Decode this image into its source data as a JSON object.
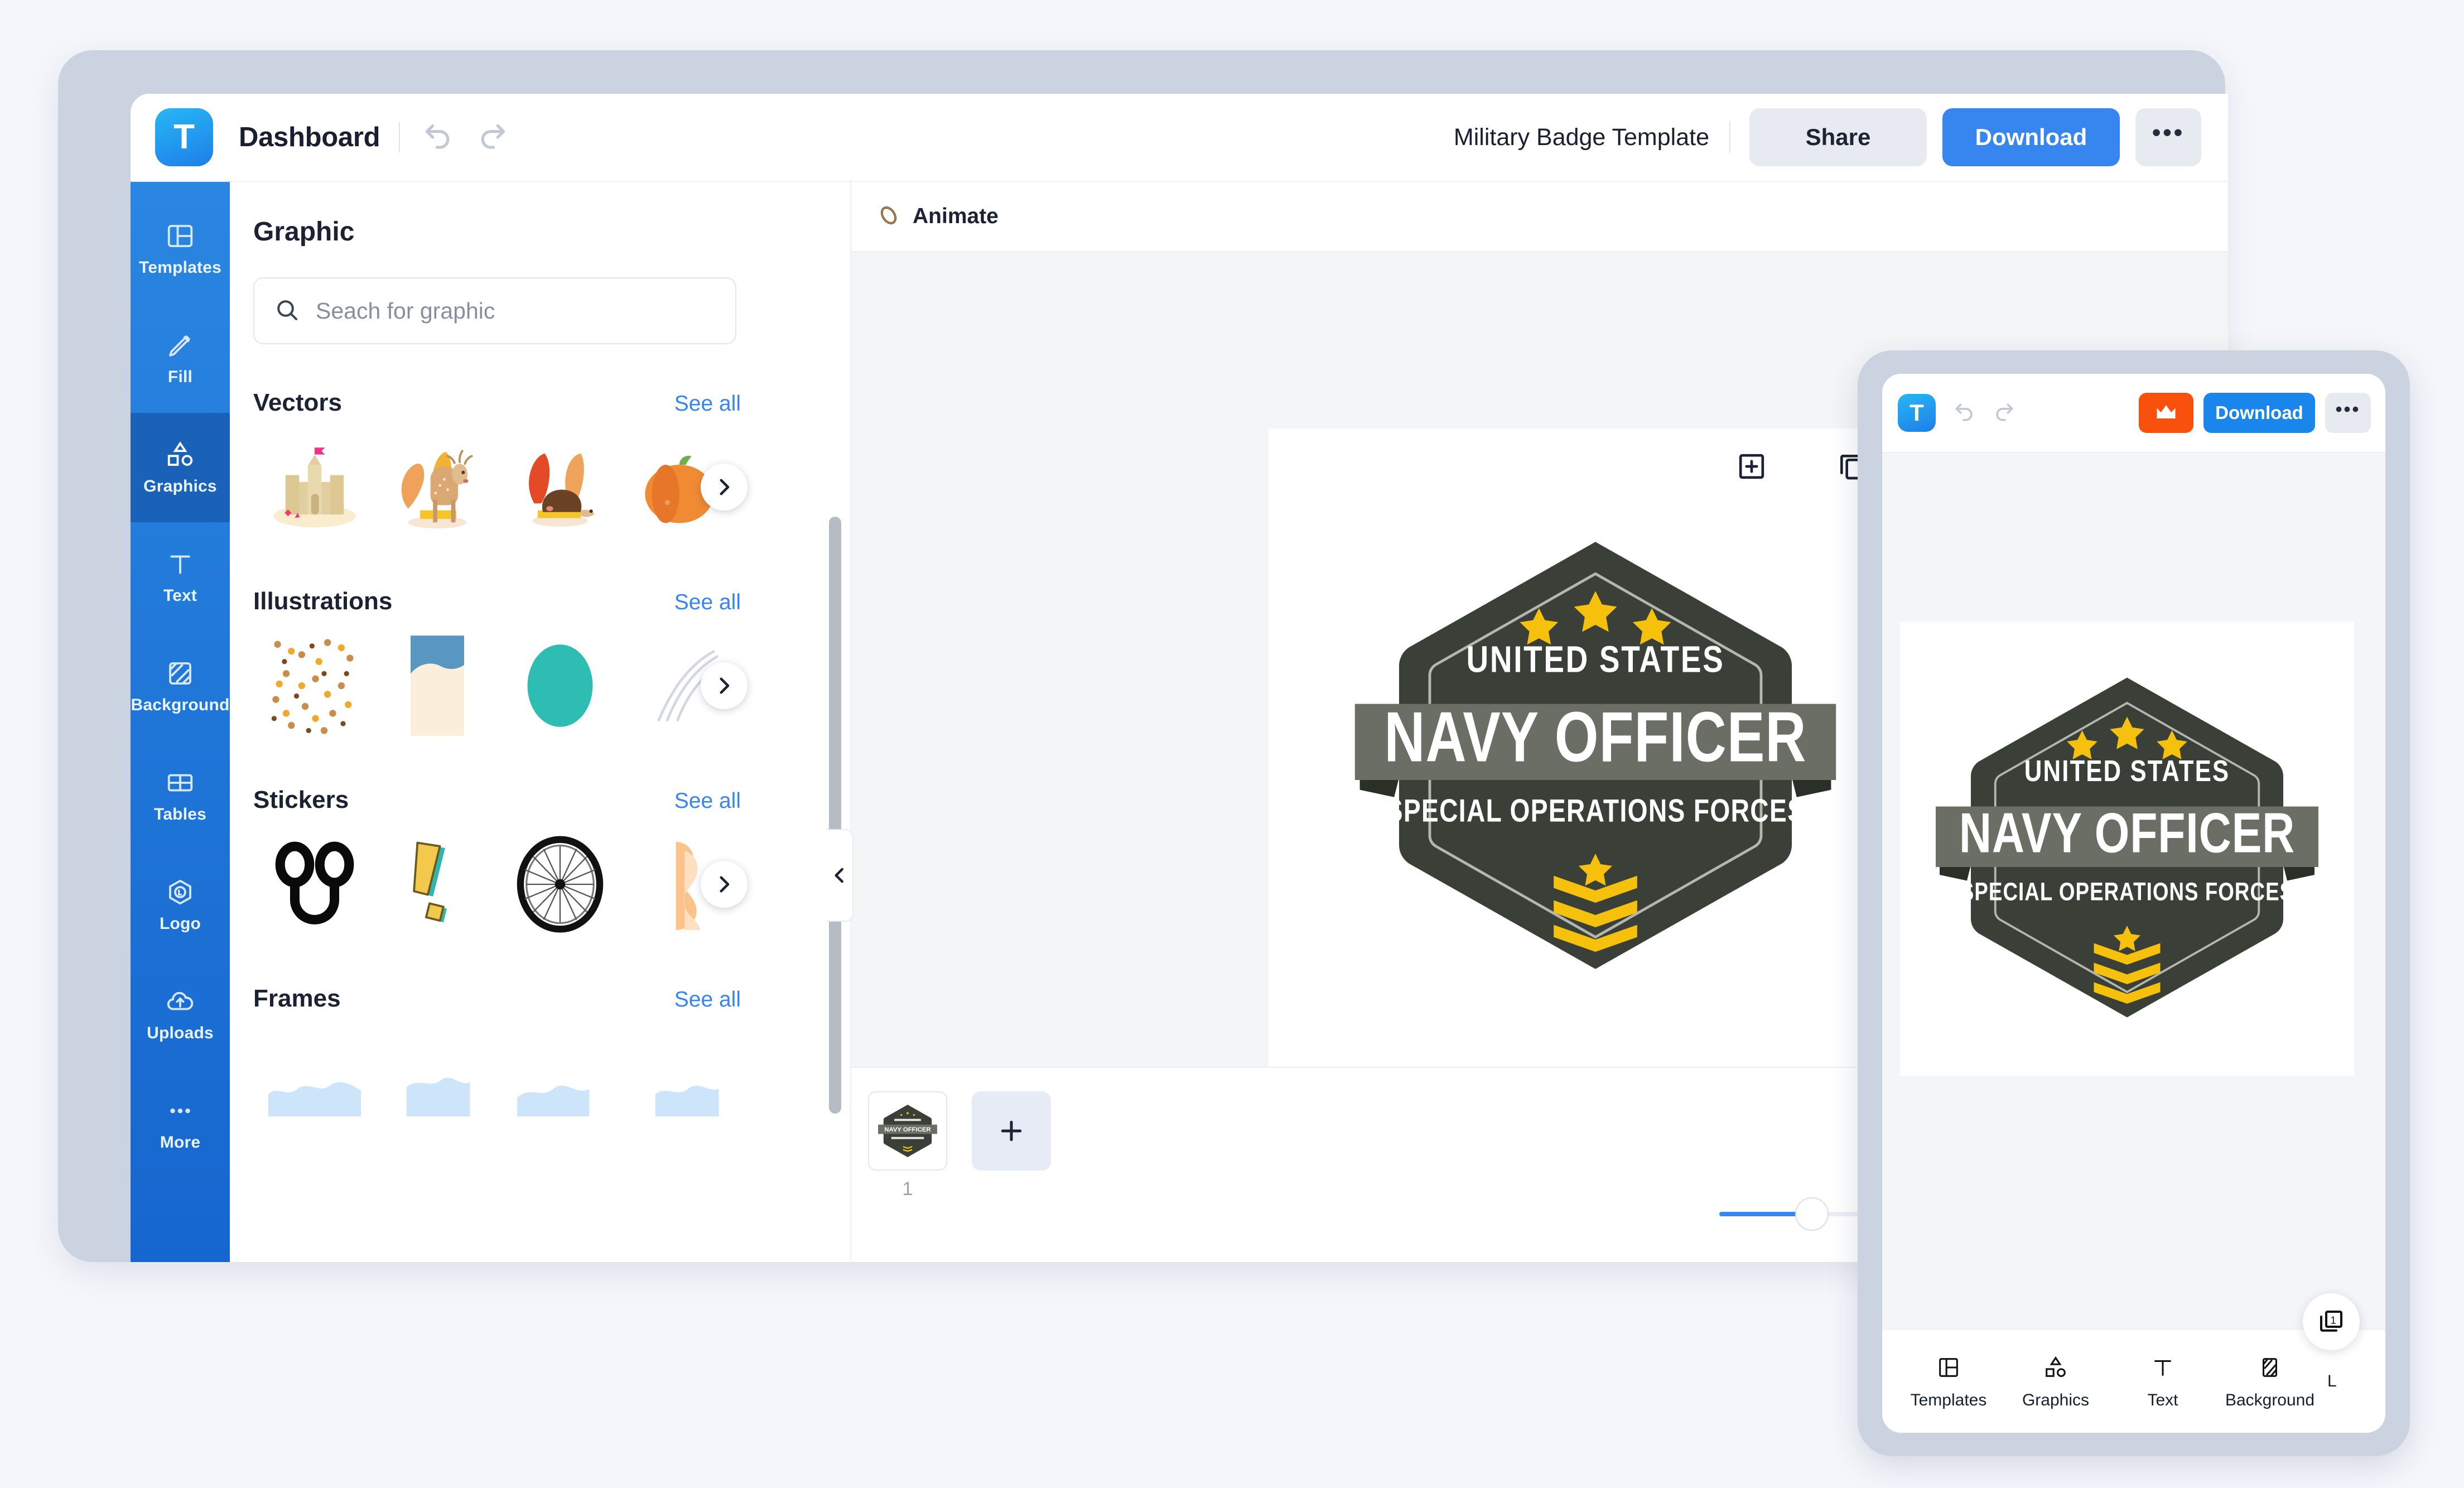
{
  "app": {
    "brand_letter": "T",
    "dashboard_label": "Dashboard",
    "document_name": "Military Badge Template",
    "accent_blue": "#3786f0",
    "rail_blue": "#1a62b8",
    "crown_orange": "#f8500d"
  },
  "topbar": {
    "undo_icon": "undo-icon",
    "redo_icon": "redo-icon",
    "share_label": "Share",
    "download_label": "Download",
    "more_label": "•••"
  },
  "sidebar": {
    "items": [
      {
        "label": "Templates",
        "icon": "templates-icon",
        "active": false
      },
      {
        "label": "Fill",
        "icon": "pen-icon",
        "active": false
      },
      {
        "label": "Graphics",
        "icon": "shapes-icon",
        "active": true
      },
      {
        "label": "Text",
        "icon": "text-icon",
        "active": false
      },
      {
        "label": "Background",
        "icon": "hatch-icon",
        "active": false
      },
      {
        "label": "Tables",
        "icon": "table-icon",
        "active": false
      },
      {
        "label": "Logo",
        "icon": "logo-hex-icon",
        "active": false
      },
      {
        "label": "Uploads",
        "icon": "upload-cloud-icon",
        "active": false
      },
      {
        "label": "More",
        "icon": "ellipsis-icon",
        "active": false
      }
    ]
  },
  "graphics_panel": {
    "title": "Graphic",
    "search_placeholder": "Seach for graphic",
    "search_value": "",
    "search_icon": "search-icon",
    "see_all_label": "See all",
    "next_icon": "chevron-right-icon",
    "sections": [
      {
        "title": "Vectors",
        "thumbs": [
          "sandcastle",
          "autumn-deer",
          "autumn-hedgehog",
          "pumpkin"
        ]
      },
      {
        "title": "Illustrations",
        "thumbs": [
          "falling-leaves-pattern",
          "beach-scene",
          "teal-ellipse",
          "feather-swirl"
        ]
      },
      {
        "title": "Stickers",
        "thumbs": [
          "black-glasses",
          "yellow-exclamation",
          "bicycle-wheel",
          "orange-silhouette"
        ]
      },
      {
        "title": "Frames",
        "thumbs": [
          "frame-wave-1",
          "frame-wave-2",
          "frame-wave-3",
          "frame-wave-4"
        ]
      }
    ],
    "collapse_icon": "chevron-left-icon"
  },
  "canvas": {
    "animate_label": "Animate",
    "animate_icon": "animate-icon",
    "add_page_icon": "add-box-icon",
    "duplicate_icon": "duplicate-icon",
    "collapse_icon": "chevron-down-icon",
    "zoom_percent": 38
  },
  "pages": {
    "page_number": "1",
    "add_icon": "plus-icon"
  },
  "badge": {
    "top_text": "UNITED STATES",
    "main_text": "NAVY OFFICER",
    "sub_text": "SPECIAL OPERATIONS FORCES",
    "star_count": 3,
    "chevron_count": 3,
    "dark_color": "#3a4038",
    "ribbon_color": "#6b6e64",
    "gold_color": "#f5c10d",
    "text_color": "#ffffff"
  },
  "mobile": {
    "brand_letter": "T",
    "undo_icon": "undo-icon",
    "redo_icon": "redo-icon",
    "crown_icon": "crown-icon",
    "download_label": "Download",
    "more_label": "•••",
    "page_badge_label": "1",
    "page_badge_icon": "pages-icon",
    "nav": [
      {
        "label": "Templates",
        "icon": "templates-icon"
      },
      {
        "label": "Graphics",
        "icon": "shapes-icon"
      },
      {
        "label": "Text",
        "icon": "text-icon"
      },
      {
        "label": "Background",
        "icon": "hatch-icon"
      }
    ],
    "nav_cut_label": "L"
  }
}
